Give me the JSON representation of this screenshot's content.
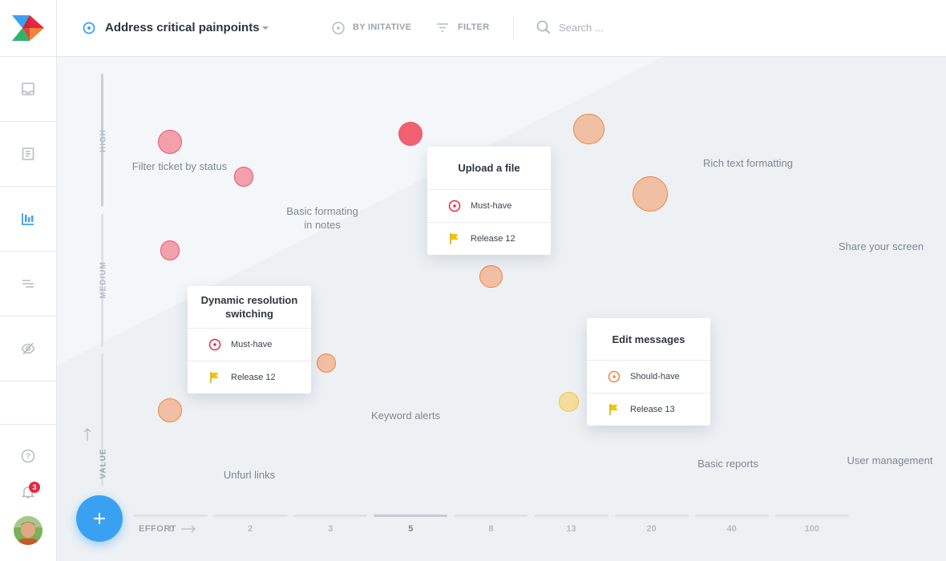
{
  "header": {
    "title": "Address critical painpoints",
    "group_by_label": "BY INITATIVE",
    "filter_label": "FILTER",
    "search_placeholder": "Search ..."
  },
  "sidebar": {
    "notification_count": "3"
  },
  "colors": {
    "accent": "#3aa1f2",
    "must_have": "#e8263f",
    "should_have": "#f0843a",
    "could_have": "#f0c84b",
    "release_flag": "#f5c400"
  },
  "chart_data": {
    "type": "scatter",
    "xlabel": "EFFORT",
    "ylabel": "VALUE",
    "x_ticks": [
      "1",
      "2",
      "3",
      "5",
      "8",
      "13",
      "20",
      "40",
      "100"
    ],
    "x_selected": "5",
    "y_levels": [
      "HIGH",
      "MEDIUM",
      "LOW"
    ],
    "points": [
      {
        "label": "Filter ticket by status",
        "effort": "1",
        "value": 0.84,
        "priority": "must",
        "size": 1
      },
      {
        "label": "Basic formating in notes",
        "effort": "2",
        "value": 0.76,
        "priority": "must",
        "size": 0.6
      },
      {
        "label": "Upload a file",
        "effort": "5",
        "value": 0.86,
        "priority": "must",
        "size": 1
      },
      {
        "label": "Dynamic resolution switching",
        "effort": "1",
        "value": 0.59,
        "priority": "must",
        "size": 0.6
      },
      {
        "label": "Rich text formatting",
        "effort": "13",
        "value": 0.87,
        "priority": "should",
        "size": 1.6
      },
      {
        "label": "Share your screen",
        "effort": "20",
        "value": 0.72,
        "priority": "should",
        "size": 2
      },
      {
        "label": "Edit messages",
        "effort": "8",
        "value": 0.53,
        "priority": "should",
        "size": 0.9
      },
      {
        "label": "Keyword alerts",
        "effort": "3",
        "value": 0.33,
        "priority": "should",
        "size": 0.6
      },
      {
        "label": "Unfurl links",
        "effort": "1",
        "value": 0.22,
        "priority": "should",
        "size": 1
      },
      {
        "label": "Basic reports",
        "effort": "13",
        "value": 0.24,
        "priority": "could",
        "size": 0.6
      },
      {
        "label": "User management",
        "effort": "20",
        "value": 0.29,
        "priority": "could",
        "size": 1.3
      }
    ]
  },
  "cards": {
    "upload": {
      "title": "Upload a file",
      "priority": "Must-have",
      "release": "Release 12"
    },
    "dynamic": {
      "title": "Dynamic resolution switching",
      "priority": "Must-have",
      "release": "Release 12"
    },
    "edit": {
      "title": "Edit messages",
      "priority": "Should-have",
      "release": "Release 13"
    }
  },
  "labels": {
    "filter_ticket": "Filter ticket by status",
    "basic_formating": "Basic formating in notes",
    "rich_text": "Rich text formatting",
    "share_screen": "Share your screen",
    "keyword_alerts": "Keyword alerts",
    "unfurl_links": "Unfurl links",
    "basic_reports": "Basic reports",
    "user_management": "User management"
  }
}
